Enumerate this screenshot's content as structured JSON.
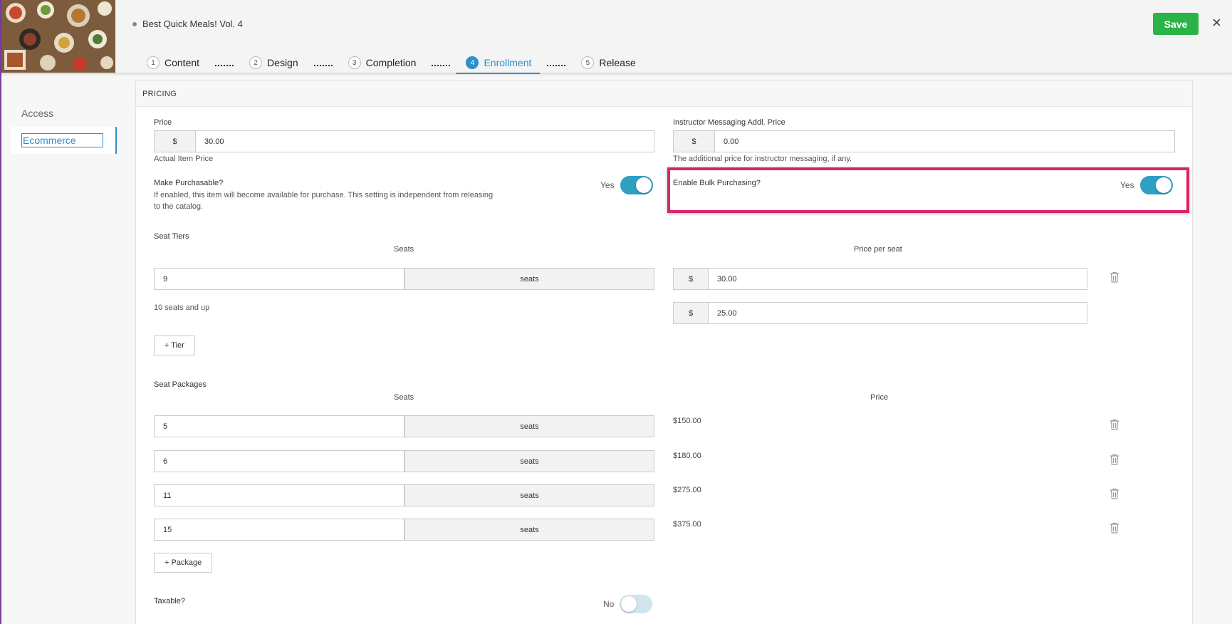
{
  "header": {
    "title": "Best Quick Meals! Vol. 4",
    "save_label": "Save",
    "close_label": "×",
    "steps": [
      {
        "num": "1",
        "label": "Content"
      },
      {
        "num": "2",
        "label": "Design"
      },
      {
        "num": "3",
        "label": "Completion"
      },
      {
        "num": "4",
        "label": "Enrollment"
      },
      {
        "num": "5",
        "label": "Release"
      }
    ],
    "active_step": "Enrollment"
  },
  "sidebar": {
    "items": [
      {
        "label": "Access"
      },
      {
        "label": "Ecommerce"
      }
    ],
    "active": "Ecommerce"
  },
  "pricing": {
    "section_title": "PRICING",
    "price": {
      "label": "Price",
      "currency": "$",
      "value": "30.00",
      "help": "Actual Item Price"
    },
    "instructor": {
      "label": "Instructor Messaging Addl. Price",
      "currency": "$",
      "value": "0.00",
      "help": "The additional price for instructor messaging, if any."
    },
    "purchasable": {
      "label": "Make Purchasable?",
      "help": "If enabled, this item will become available for purchase. This setting is independent from releasing to the catalog.",
      "state_label": "Yes",
      "enabled": true
    },
    "bulk": {
      "label": "Enable Bulk Purchasing?",
      "state_label": "Yes",
      "enabled": true
    },
    "seat_tiers": {
      "label": "Seat Tiers",
      "col_seats": "Seats",
      "col_price": "Price per seat",
      "rows": [
        {
          "seats": "9",
          "unit": "seats",
          "currency": "$",
          "price": "30.00"
        },
        {
          "seats_text": "10 seats and up",
          "currency": "$",
          "price": "25.00"
        }
      ],
      "add_label": "+ Tier"
    },
    "seat_packages": {
      "label": "Seat Packages",
      "col_seats": "Seats",
      "col_price": "Price",
      "rows": [
        {
          "seats": "5",
          "unit": "seats",
          "price": "$150.00"
        },
        {
          "seats": "6",
          "unit": "seats",
          "price": "$180.00"
        },
        {
          "seats": "11",
          "unit": "seats",
          "price": "$275.00"
        },
        {
          "seats": "15",
          "unit": "seats",
          "price": "$375.00"
        }
      ],
      "add_label": "+ Package"
    },
    "taxable": {
      "label": "Taxable?",
      "state_label": "No",
      "enabled": false
    }
  },
  "colors": {
    "accent": "#2e8fc9",
    "save": "#28b446",
    "highlight": "#d6266a",
    "toggle_on": "#2f9fc2"
  }
}
